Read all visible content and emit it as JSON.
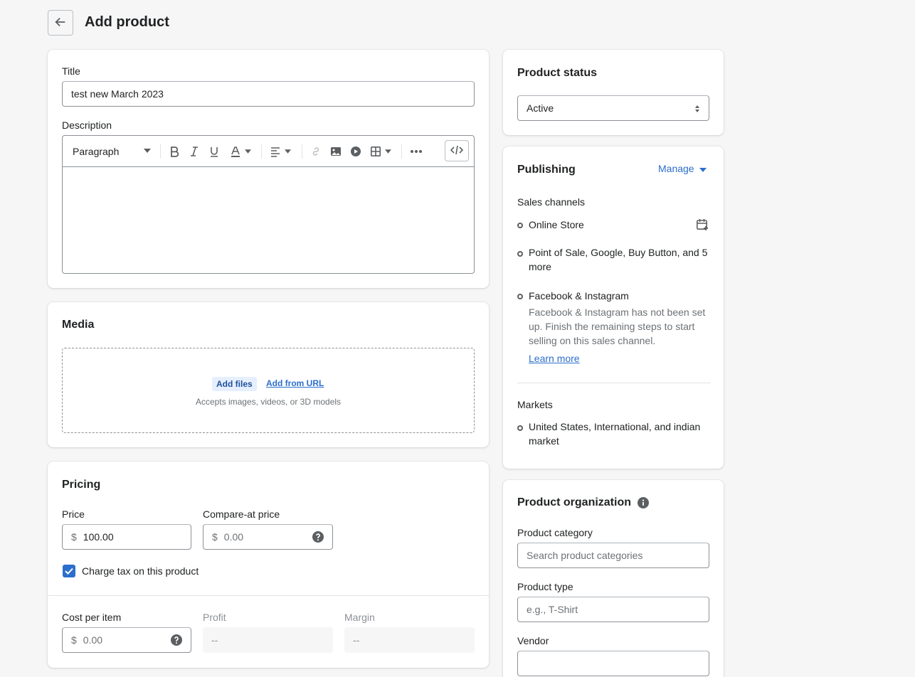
{
  "header": {
    "title": "Add product"
  },
  "main": {
    "title_label": "Title",
    "title_value": "test new March 2023",
    "description_label": "Description",
    "editor": {
      "format": "Paragraph"
    },
    "media": {
      "heading": "Media",
      "add_files": "Add files",
      "add_from_url": "Add from URL",
      "hint": "Accepts images, videos, or 3D models"
    },
    "pricing": {
      "heading": "Pricing",
      "price_label": "Price",
      "currency": "$",
      "price_value": "100.00",
      "compare_label": "Compare-at price",
      "compare_placeholder": "0.00",
      "charge_tax_label": "Charge tax on this product",
      "charge_tax_checked": true,
      "cost_label": "Cost per item",
      "cost_placeholder": "0.00",
      "profit_label": "Profit",
      "profit_value": "--",
      "margin_label": "Margin",
      "margin_value": "--"
    }
  },
  "side": {
    "status": {
      "heading": "Product status",
      "selected": "Active"
    },
    "publishing": {
      "heading": "Publishing",
      "manage": "Manage",
      "channels_heading": "Sales channels",
      "channels": [
        {
          "name": "Online Store"
        },
        {
          "name": "Point of Sale, Google, Buy Button, and 5 more"
        },
        {
          "name": "Facebook & Instagram"
        }
      ],
      "fb_note": "Facebook & Instagram has not been set up. Finish the remaining steps to start selling on this sales channel.",
      "learn_more": "Learn more",
      "markets_heading": "Markets",
      "markets": "United States, International, and indian market"
    },
    "organization": {
      "heading": "Product organization",
      "category_label": "Product category",
      "category_placeholder": "Search product categories",
      "type_label": "Product type",
      "type_placeholder": "e.g., T-Shirt",
      "vendor_label": "Vendor",
      "vendor_value": ""
    }
  },
  "colors": {
    "accent": "#2c6ecb",
    "checkbox": "#2c6ecb",
    "background": "#f6f6f7"
  },
  "icons": [
    "arrow-left-icon",
    "chevron-down-icon",
    "bold-icon",
    "italic-icon",
    "underline-icon",
    "text-color-icon",
    "align-icon",
    "link-icon",
    "image-icon",
    "video-icon",
    "table-icon",
    "more-icon",
    "code-icon",
    "question-icon",
    "calendar-icon",
    "info-icon",
    "select-arrows-icon",
    "checkmark-icon"
  ]
}
